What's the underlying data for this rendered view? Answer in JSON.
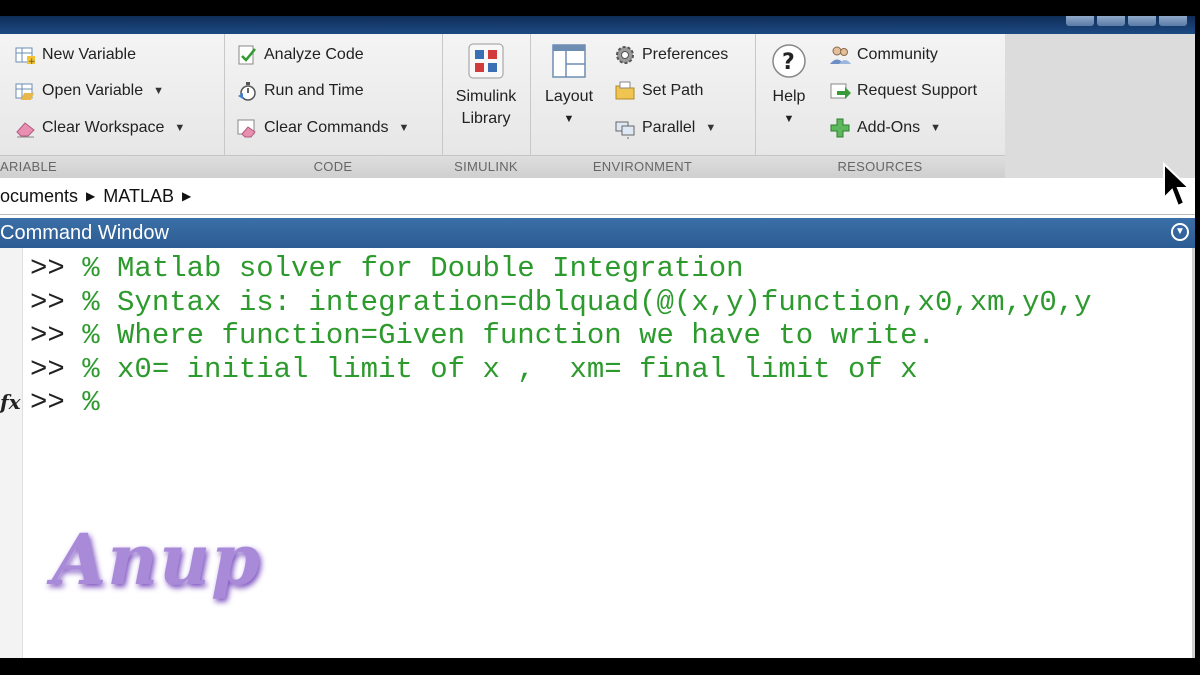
{
  "ribbon": {
    "variable": {
      "label": "ARIABLE",
      "new_variable": "New Variable",
      "open_variable": "Open Variable",
      "clear_workspace": "Clear Workspace"
    },
    "code": {
      "label": "CODE",
      "analyze_code": "Analyze Code",
      "run_and_time": "Run and Time",
      "clear_commands": "Clear Commands"
    },
    "simulink": {
      "label": "SIMULINK",
      "library_line1": "Simulink",
      "library_line2": "Library"
    },
    "environment": {
      "label": "ENVIRONMENT",
      "layout": "Layout",
      "preferences": "Preferences",
      "set_path": "Set Path",
      "parallel": "Parallel"
    },
    "resources": {
      "label": "RESOURCES",
      "help": "Help",
      "community": "Community",
      "request_support": "Request Support",
      "add_ons": "Add-Ons"
    }
  },
  "address": {
    "crumb1": "ocuments",
    "crumb2": "MATLAB"
  },
  "command_window": {
    "title": "Command Window",
    "fx": "fx",
    "lines": [
      {
        "prompt": ">> ",
        "text": "% Matlab solver for Double Integration"
      },
      {
        "prompt": ">> ",
        "text": "% Syntax is: integration=dblquad(@(x,y)function,x0,xm,y0,y"
      },
      {
        "prompt": ">> ",
        "text": "% Where function=Given function we have to write."
      },
      {
        "prompt": ">> ",
        "text": "% x0= initial limit of x ,  xm= final limit of x"
      },
      {
        "prompt": ">> ",
        "text": "%"
      }
    ]
  },
  "watermark": "Anup"
}
